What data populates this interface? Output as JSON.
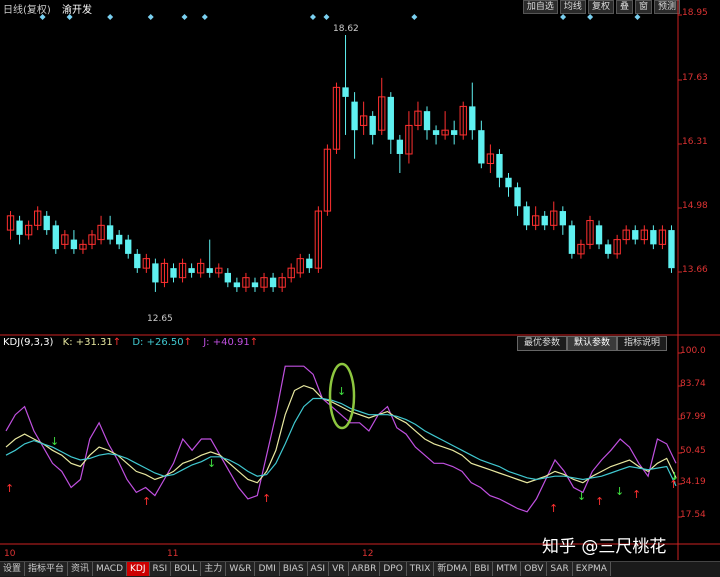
{
  "header": {
    "title": "日线(复权)",
    "stock": "渝开发",
    "buttons": [
      "加自选",
      "均线",
      "复权",
      "叠",
      "窗",
      "预测"
    ]
  },
  "price_axis": [
    "18.95",
    "17.63",
    "16.31",
    "14.98",
    "13.66"
  ],
  "labels": {
    "high": "18.62",
    "low": "12.65"
  },
  "indicator": {
    "name": "KDJ(9,3,3)",
    "k": "K: +31.31",
    "d": "D: +26.50",
    "j": "J: +40.91",
    "buttons": [
      "最优参数",
      "默认参数",
      "指标说明"
    ],
    "active_button": "默认参数"
  },
  "ind_axis": [
    "100.0",
    "83.74",
    "67.99",
    "50.45",
    "34.19",
    "17.54"
  ],
  "dates": [
    "10",
    "11",
    "12"
  ],
  "tabs": [
    "设置",
    "指标平台",
    "资讯",
    "MACD",
    "KDJ",
    "RSI",
    "BOLL",
    "主力",
    "W&R",
    "DMI",
    "BIAS",
    "ASI",
    "VR",
    "ARBR",
    "DPO",
    "TRIX",
    "新DMA",
    "BBI",
    "MTM",
    "OBV",
    "SAR",
    "EXPMA"
  ],
  "active_tab": "KDJ",
  "watermark": "知乎 @三尺桃花",
  "colors": {
    "up": "#ff3030",
    "down": "#5ff0f0",
    "k_line": "#e8e8a0",
    "d_line": "#40c8d0",
    "j_line": "#c050e0",
    "axis": "#cc2222",
    "circle": "#8dc63f"
  },
  "chart_data": {
    "type": "candlestick",
    "candles": [
      [
        14.5,
        14.8,
        14.3,
        14.9
      ],
      [
        14.7,
        14.4,
        14.2,
        14.8
      ],
      [
        14.4,
        14.6,
        14.3,
        14.7
      ],
      [
        14.6,
        14.9,
        14.5,
        15.0
      ],
      [
        14.8,
        14.5,
        14.4,
        14.9
      ],
      [
        14.6,
        14.1,
        14.0,
        14.7
      ],
      [
        14.2,
        14.4,
        14.1,
        14.5
      ],
      [
        14.3,
        14.1,
        14.0,
        14.5
      ],
      [
        14.1,
        14.2,
        14.0,
        14.3
      ],
      [
        14.2,
        14.4,
        14.1,
        14.5
      ],
      [
        14.3,
        14.6,
        14.2,
        14.8
      ],
      [
        14.6,
        14.3,
        14.2,
        14.8
      ],
      [
        14.4,
        14.2,
        14.1,
        14.5
      ],
      [
        14.3,
        14.0,
        13.9,
        14.4
      ],
      [
        14.0,
        13.7,
        13.6,
        14.1
      ],
      [
        13.7,
        13.9,
        13.6,
        14.0
      ],
      [
        13.8,
        13.4,
        13.2,
        13.9
      ],
      [
        13.4,
        13.8,
        13.3,
        13.9
      ],
      [
        13.7,
        13.5,
        13.4,
        13.8
      ],
      [
        13.5,
        13.8,
        13.4,
        13.9
      ],
      [
        13.7,
        13.6,
        13.5,
        13.8
      ],
      [
        13.6,
        13.8,
        13.5,
        13.9
      ],
      [
        13.7,
        13.6,
        13.5,
        14.3
      ],
      [
        13.6,
        13.7,
        13.5,
        13.8
      ],
      [
        13.6,
        13.4,
        13.3,
        13.7
      ],
      [
        13.4,
        13.3,
        13.2,
        13.5
      ],
      [
        13.3,
        13.5,
        13.2,
        13.6
      ],
      [
        13.4,
        13.3,
        13.2,
        13.5
      ],
      [
        13.3,
        13.5,
        13.2,
        13.6
      ],
      [
        13.5,
        13.3,
        13.2,
        13.6
      ],
      [
        13.3,
        13.5,
        13.2,
        13.6
      ],
      [
        13.5,
        13.7,
        13.4,
        13.8
      ],
      [
        13.6,
        13.9,
        13.5,
        14.0
      ],
      [
        13.9,
        13.7,
        13.6,
        14.0
      ],
      [
        13.7,
        14.9,
        13.6,
        15.0
      ],
      [
        14.9,
        16.2,
        14.8,
        16.3
      ],
      [
        16.2,
        17.5,
        16.1,
        17.6
      ],
      [
        17.5,
        17.3,
        16.5,
        18.6
      ],
      [
        17.2,
        16.6,
        16.0,
        17.4
      ],
      [
        16.7,
        16.9,
        16.5,
        17.2
      ],
      [
        16.9,
        16.5,
        16.3,
        17.0
      ],
      [
        16.6,
        17.3,
        16.5,
        17.7
      ],
      [
        17.3,
        16.4,
        16.1,
        17.4
      ],
      [
        16.4,
        16.1,
        15.7,
        16.5
      ],
      [
        16.1,
        16.7,
        15.9,
        17.0
      ],
      [
        16.7,
        17.0,
        16.6,
        17.2
      ],
      [
        17.0,
        16.6,
        16.4,
        17.1
      ],
      [
        16.6,
        16.5,
        16.3,
        16.7
      ],
      [
        16.5,
        16.6,
        16.4,
        17.0
      ],
      [
        16.6,
        16.5,
        16.3,
        16.8
      ],
      [
        16.5,
        17.1,
        16.4,
        17.2
      ],
      [
        17.1,
        16.6,
        16.4,
        17.6
      ],
      [
        16.6,
        15.9,
        15.8,
        16.8
      ],
      [
        15.9,
        16.1,
        15.7,
        16.3
      ],
      [
        16.1,
        15.6,
        15.4,
        16.2
      ],
      [
        15.6,
        15.4,
        15.2,
        15.7
      ],
      [
        15.4,
        15.0,
        14.8,
        15.5
      ],
      [
        15.0,
        14.6,
        14.5,
        15.1
      ],
      [
        14.6,
        14.8,
        14.5,
        15.0
      ],
      [
        14.8,
        14.6,
        14.5,
        14.9
      ],
      [
        14.6,
        14.9,
        14.5,
        15.1
      ],
      [
        14.9,
        14.6,
        14.4,
        15.0
      ],
      [
        14.6,
        14.0,
        13.9,
        14.7
      ],
      [
        14.0,
        14.2,
        13.9,
        14.3
      ],
      [
        14.2,
        14.7,
        14.1,
        14.8
      ],
      [
        14.6,
        14.2,
        14.1,
        14.7
      ],
      [
        14.2,
        14.0,
        13.9,
        14.3
      ],
      [
        14.0,
        14.3,
        13.9,
        14.4
      ],
      [
        14.3,
        14.5,
        14.2,
        14.6
      ],
      [
        14.5,
        14.3,
        14.2,
        14.6
      ],
      [
        14.3,
        14.5,
        14.2,
        14.6
      ],
      [
        14.5,
        14.2,
        14.1,
        14.6
      ],
      [
        14.2,
        14.5,
        14.1,
        14.6
      ],
      [
        14.5,
        13.7,
        13.6,
        14.6
      ]
    ],
    "kdj": {
      "K": [
        50,
        55,
        58,
        55,
        52,
        48,
        45,
        40,
        38,
        45,
        50,
        48,
        45,
        40,
        35,
        33,
        30,
        32,
        35,
        40,
        42,
        45,
        47,
        45,
        40,
        35,
        30,
        28,
        35,
        48,
        70,
        85,
        88,
        86,
        80,
        78,
        75,
        72,
        70,
        68,
        70,
        72,
        68,
        65,
        60,
        55,
        52,
        50,
        48,
        45,
        40,
        38,
        36,
        34,
        32,
        30,
        28,
        30,
        32,
        35,
        33,
        30,
        28,
        32,
        35,
        38,
        40,
        42,
        38,
        35,
        40,
        43,
        31
      ],
      "D": [
        45,
        48,
        52,
        54,
        52,
        50,
        47,
        44,
        42,
        43,
        45,
        46,
        45,
        43,
        40,
        37,
        34,
        32,
        33,
        36,
        39,
        41,
        44,
        44,
        42,
        39,
        35,
        32,
        33,
        40,
        52,
        65,
        75,
        80,
        80,
        79,
        77,
        74,
        72,
        70,
        70,
        70,
        69,
        67,
        64,
        60,
        57,
        54,
        51,
        48,
        45,
        42,
        40,
        38,
        35,
        33,
        31,
        30,
        31,
        32,
        32,
        31,
        30,
        31,
        32,
        34,
        36,
        38,
        37,
        36,
        37,
        38,
        26
      ],
      "J": [
        60,
        70,
        75,
        60,
        50,
        40,
        35,
        25,
        30,
        55,
        65,
        52,
        42,
        30,
        22,
        25,
        20,
        30,
        40,
        55,
        48,
        55,
        55,
        45,
        35,
        25,
        18,
        20,
        45,
        70,
        100,
        100,
        100,
        95,
        80,
        75,
        70,
        65,
        65,
        60,
        70,
        75,
        62,
        58,
        50,
        45,
        40,
        40,
        38,
        35,
        28,
        25,
        20,
        18,
        15,
        12,
        10,
        18,
        30,
        42,
        35,
        25,
        22,
        35,
        42,
        48,
        55,
        50,
        40,
        32,
        55,
        52,
        40
      ]
    }
  }
}
